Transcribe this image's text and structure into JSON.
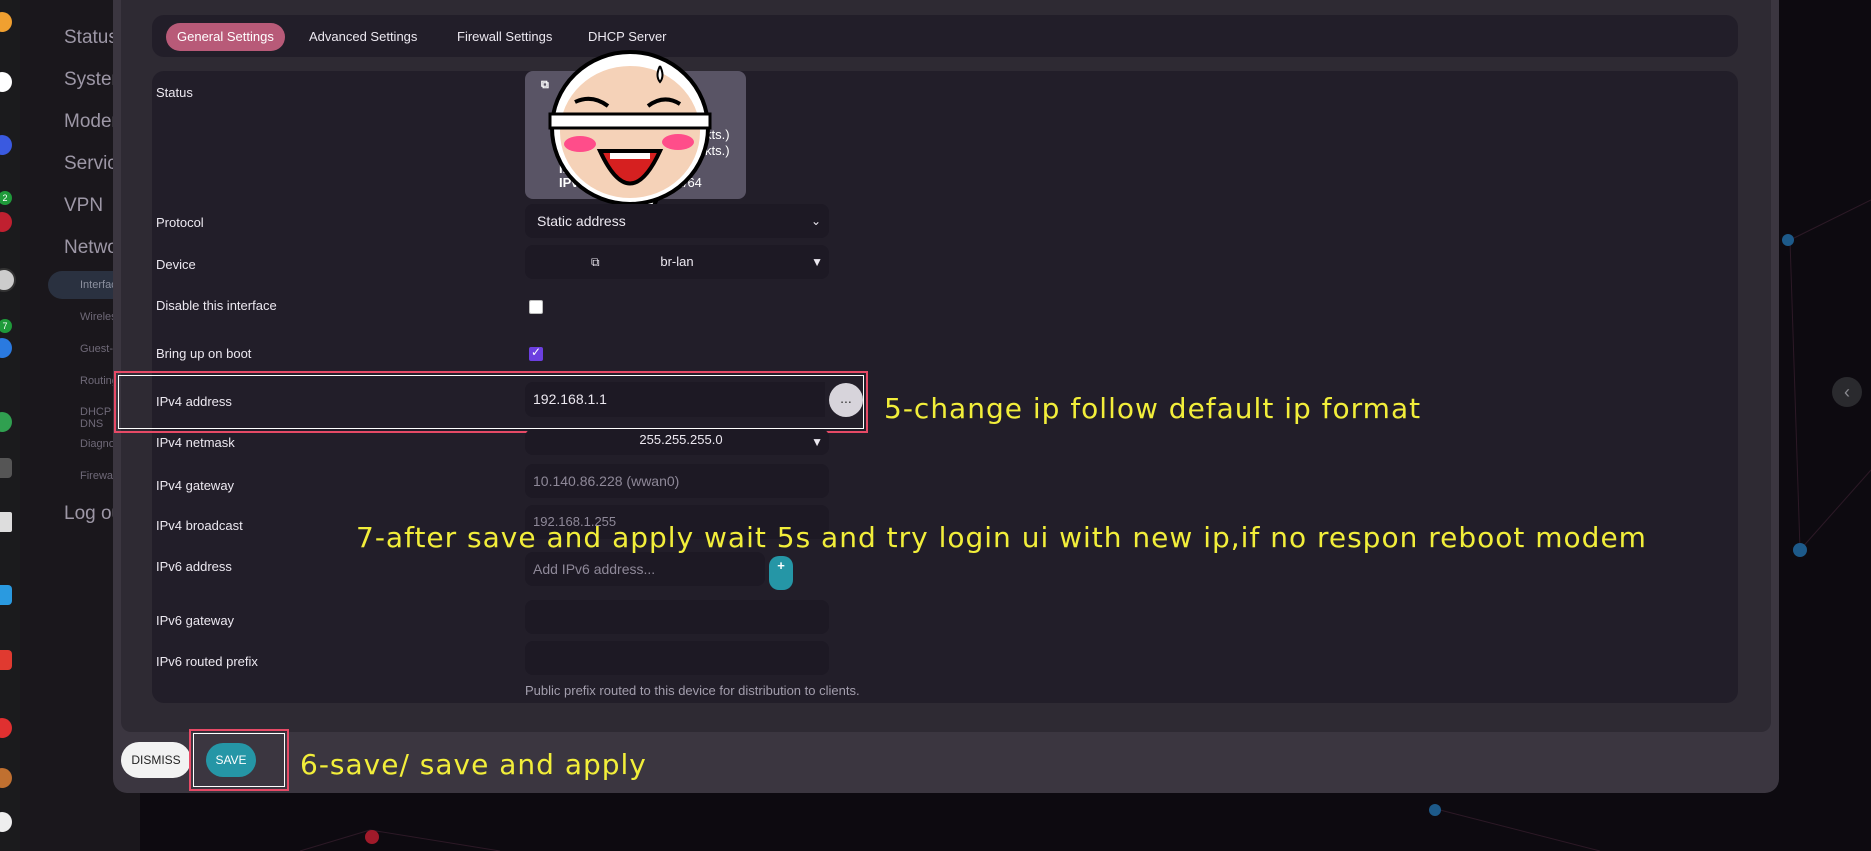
{
  "sidebar": {
    "main_items": [
      "Status",
      "System",
      "Modem",
      "Services",
      "VPN",
      "Network"
    ],
    "sub_items": [
      "Interfaces",
      "Wireless",
      "Guest-wifi",
      "Routing",
      "DHCP and DNS",
      "Diagnostics",
      "Firewall"
    ],
    "logout": "Log out",
    "dock_badges": [
      "2",
      "7"
    ]
  },
  "tabs": [
    "General Settings",
    "Advanced Settings",
    "Firewall Settings",
    "DHCP Server"
  ],
  "form": {
    "status_label": "Status",
    "status_lines": {
      "ipv6": "IPv6:",
      "ipv6_suffix": ":1/64",
      "pkts1": "kts.)",
      "pkts2": "kts.)",
      "ip_partial": "IP"
    },
    "protocol_label": "Protocol",
    "protocol_value": "Static address",
    "device_label": "Device",
    "device_value": "br-lan",
    "disable_label": "Disable this interface",
    "boot_label": "Bring up on boot",
    "ipv4_address_label": "IPv4 address",
    "ipv4_address_value": "192.168.1.1",
    "ipv4_netmask_label": "IPv4 netmask",
    "ipv4_netmask_value": "255.255.255.0",
    "ipv4_gateway_label": "IPv4 gateway",
    "ipv4_gateway_placeholder": "10.140.86.228 (wwan0)",
    "ipv4_broadcast_label": "IPv4 broadcast",
    "ipv4_broadcast_placeholder": "192.168.1.255",
    "ipv6_address_label": "IPv6 address",
    "ipv6_address_placeholder": "Add IPv6 address...",
    "ipv6_gateway_label": "IPv6 gateway",
    "ipv6_prefix_label": "IPv6 routed prefix",
    "ipv6_prefix_hint": "Public prefix routed to this device for distribution to clients.",
    "dots": "...",
    "plus": "+"
  },
  "buttons": {
    "dismiss": "DISMISS",
    "save": "SAVE"
  },
  "annotations": {
    "step5": "5-change ip follow default ip format",
    "step6": "6-save/ save and apply",
    "step7": "7-after save and apply wait 5s and try login ui with new ip,if no respon reboot modem"
  },
  "colors": {
    "accent": "#b85a78",
    "teal": "#2596a6",
    "annotation": "#f2ee3a",
    "highlight": "#e64a66"
  }
}
